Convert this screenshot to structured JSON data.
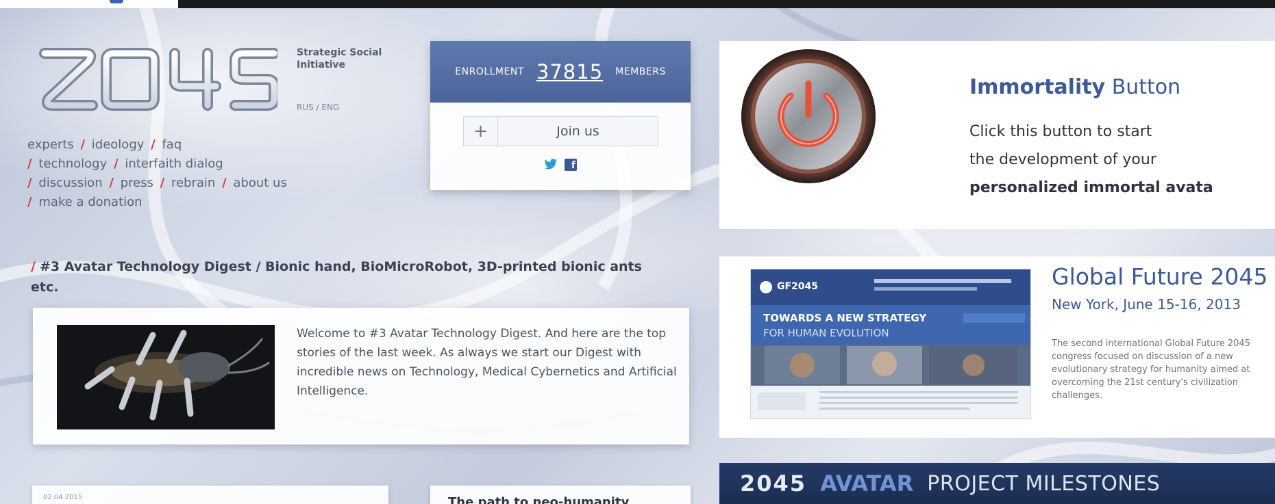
{
  "header": {
    "logo_text": "2045",
    "tagline_line1": "Strategic Social",
    "tagline_line2": "Initiative",
    "lang_switch": "RUS / ENG"
  },
  "nav": {
    "items": [
      "experts",
      "ideology",
      "faq",
      "technology",
      "interfaith dialog",
      "discussion",
      "press",
      "rebrain",
      "about us",
      "make a donation"
    ],
    "separator": "/"
  },
  "enrollment": {
    "label": "ENROLLMENT",
    "count": "37815",
    "members_label": "MEMBERS",
    "join_symbol": "+",
    "join_label": "Join us",
    "social_twitter": "twitter-icon",
    "social_facebook": "facebook-icon",
    "facebook_glyph": "f"
  },
  "digest": {
    "separator": "/",
    "title": "#3 Avatar Technology Digest / Bionic hand, BioMicroRobot, 3D-printed bionic ants etc.",
    "body": "Welcome to #3 Avatar Technology Digest. And here are the top stories of the last week. As always we start our Digest with incredible news on Technology, Medical Cybernetics and Artificial Intelligence."
  },
  "posts": {
    "date": "02.04.2015",
    "path_title": "The path to neo-humanity"
  },
  "immortality": {
    "title_bold": "Immortality",
    "title_rest": "Button",
    "line1": "Click this button to start",
    "line2": "the development of your",
    "line3": "personalized immortal avata"
  },
  "global_future": {
    "title": "Global Future 2045",
    "subtitle": "New York, June 15-16, 2013",
    "description": "The second international Global Future 2045 congress focused on discussion of a new evolutionary strategy for humanity aimed at overcoming the 21st century's civilization challenges.",
    "thumb_logo": "GF2045",
    "thumb_headline1": "TOWARDS A NEW STRATEGY",
    "thumb_headline2": "FOR HUMAN EVOLUTION"
  },
  "milestones": {
    "logo": "2045",
    "avatar_label": "AVATAR",
    "rest_label": "PROJECT MILESTONES"
  }
}
